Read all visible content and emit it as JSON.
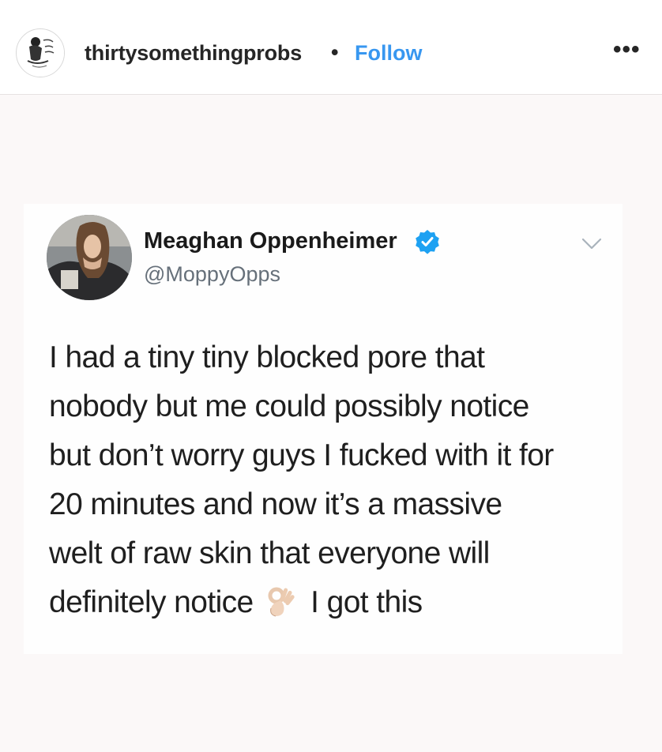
{
  "header": {
    "username": "thirtysomethingprobs",
    "separator": "•",
    "follow_label": "Follow",
    "more_label": "•••",
    "avatar_icon": "thirtysomethingprobs-logo-icon"
  },
  "tweet": {
    "display_name": "Meaghan Oppenheimer",
    "handle": "@MoppyOpps",
    "verified_icon": "verified-badge-icon",
    "menu_icon": "chevron-down-icon",
    "lines": [
      "I had a tiny tiny blocked pore that",
      "nobody but me could possibly notice",
      "but don’t worry guys I fucked with it for",
      "20 minutes and now it’s a massive",
      "welt of raw skin that everyone will"
    ],
    "last_line_before": "definitely notice",
    "last_line_emoji": "ok-hand-emoji-icon",
    "last_line_after": "I got this"
  },
  "colors": {
    "follow_blue": "#3897f0",
    "verified_blue": "#1da1f2",
    "text_dark": "#262626",
    "handle_gray": "#66707a"
  }
}
